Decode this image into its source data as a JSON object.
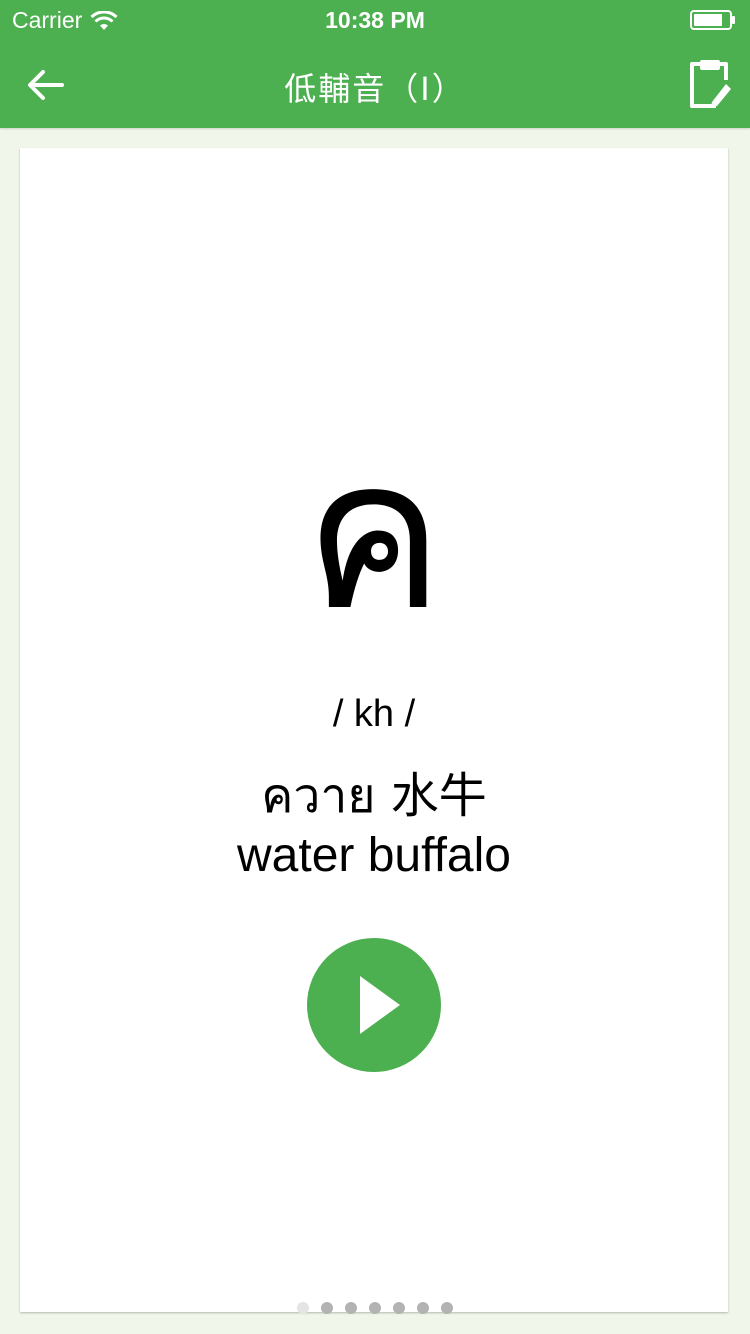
{
  "status_bar": {
    "carrier": "Carrier",
    "time": "10:38 PM"
  },
  "nav": {
    "title": "低輔音（I）",
    "back_icon": "arrow-left-icon",
    "notes_icon": "clipboard-edit-icon"
  },
  "card": {
    "letter": "ค",
    "pronunciation": "/ kh /",
    "word": "ควาย 水牛",
    "meaning": "water buffalo",
    "play_icon": "play-icon"
  },
  "pager": {
    "count": 7,
    "active_index": 0
  },
  "colors": {
    "accent": "#4caf50",
    "background": "#f0f6e9",
    "card": "#ffffff",
    "dot": "#b3b3b3",
    "dot_active": "#e4e4e4"
  }
}
